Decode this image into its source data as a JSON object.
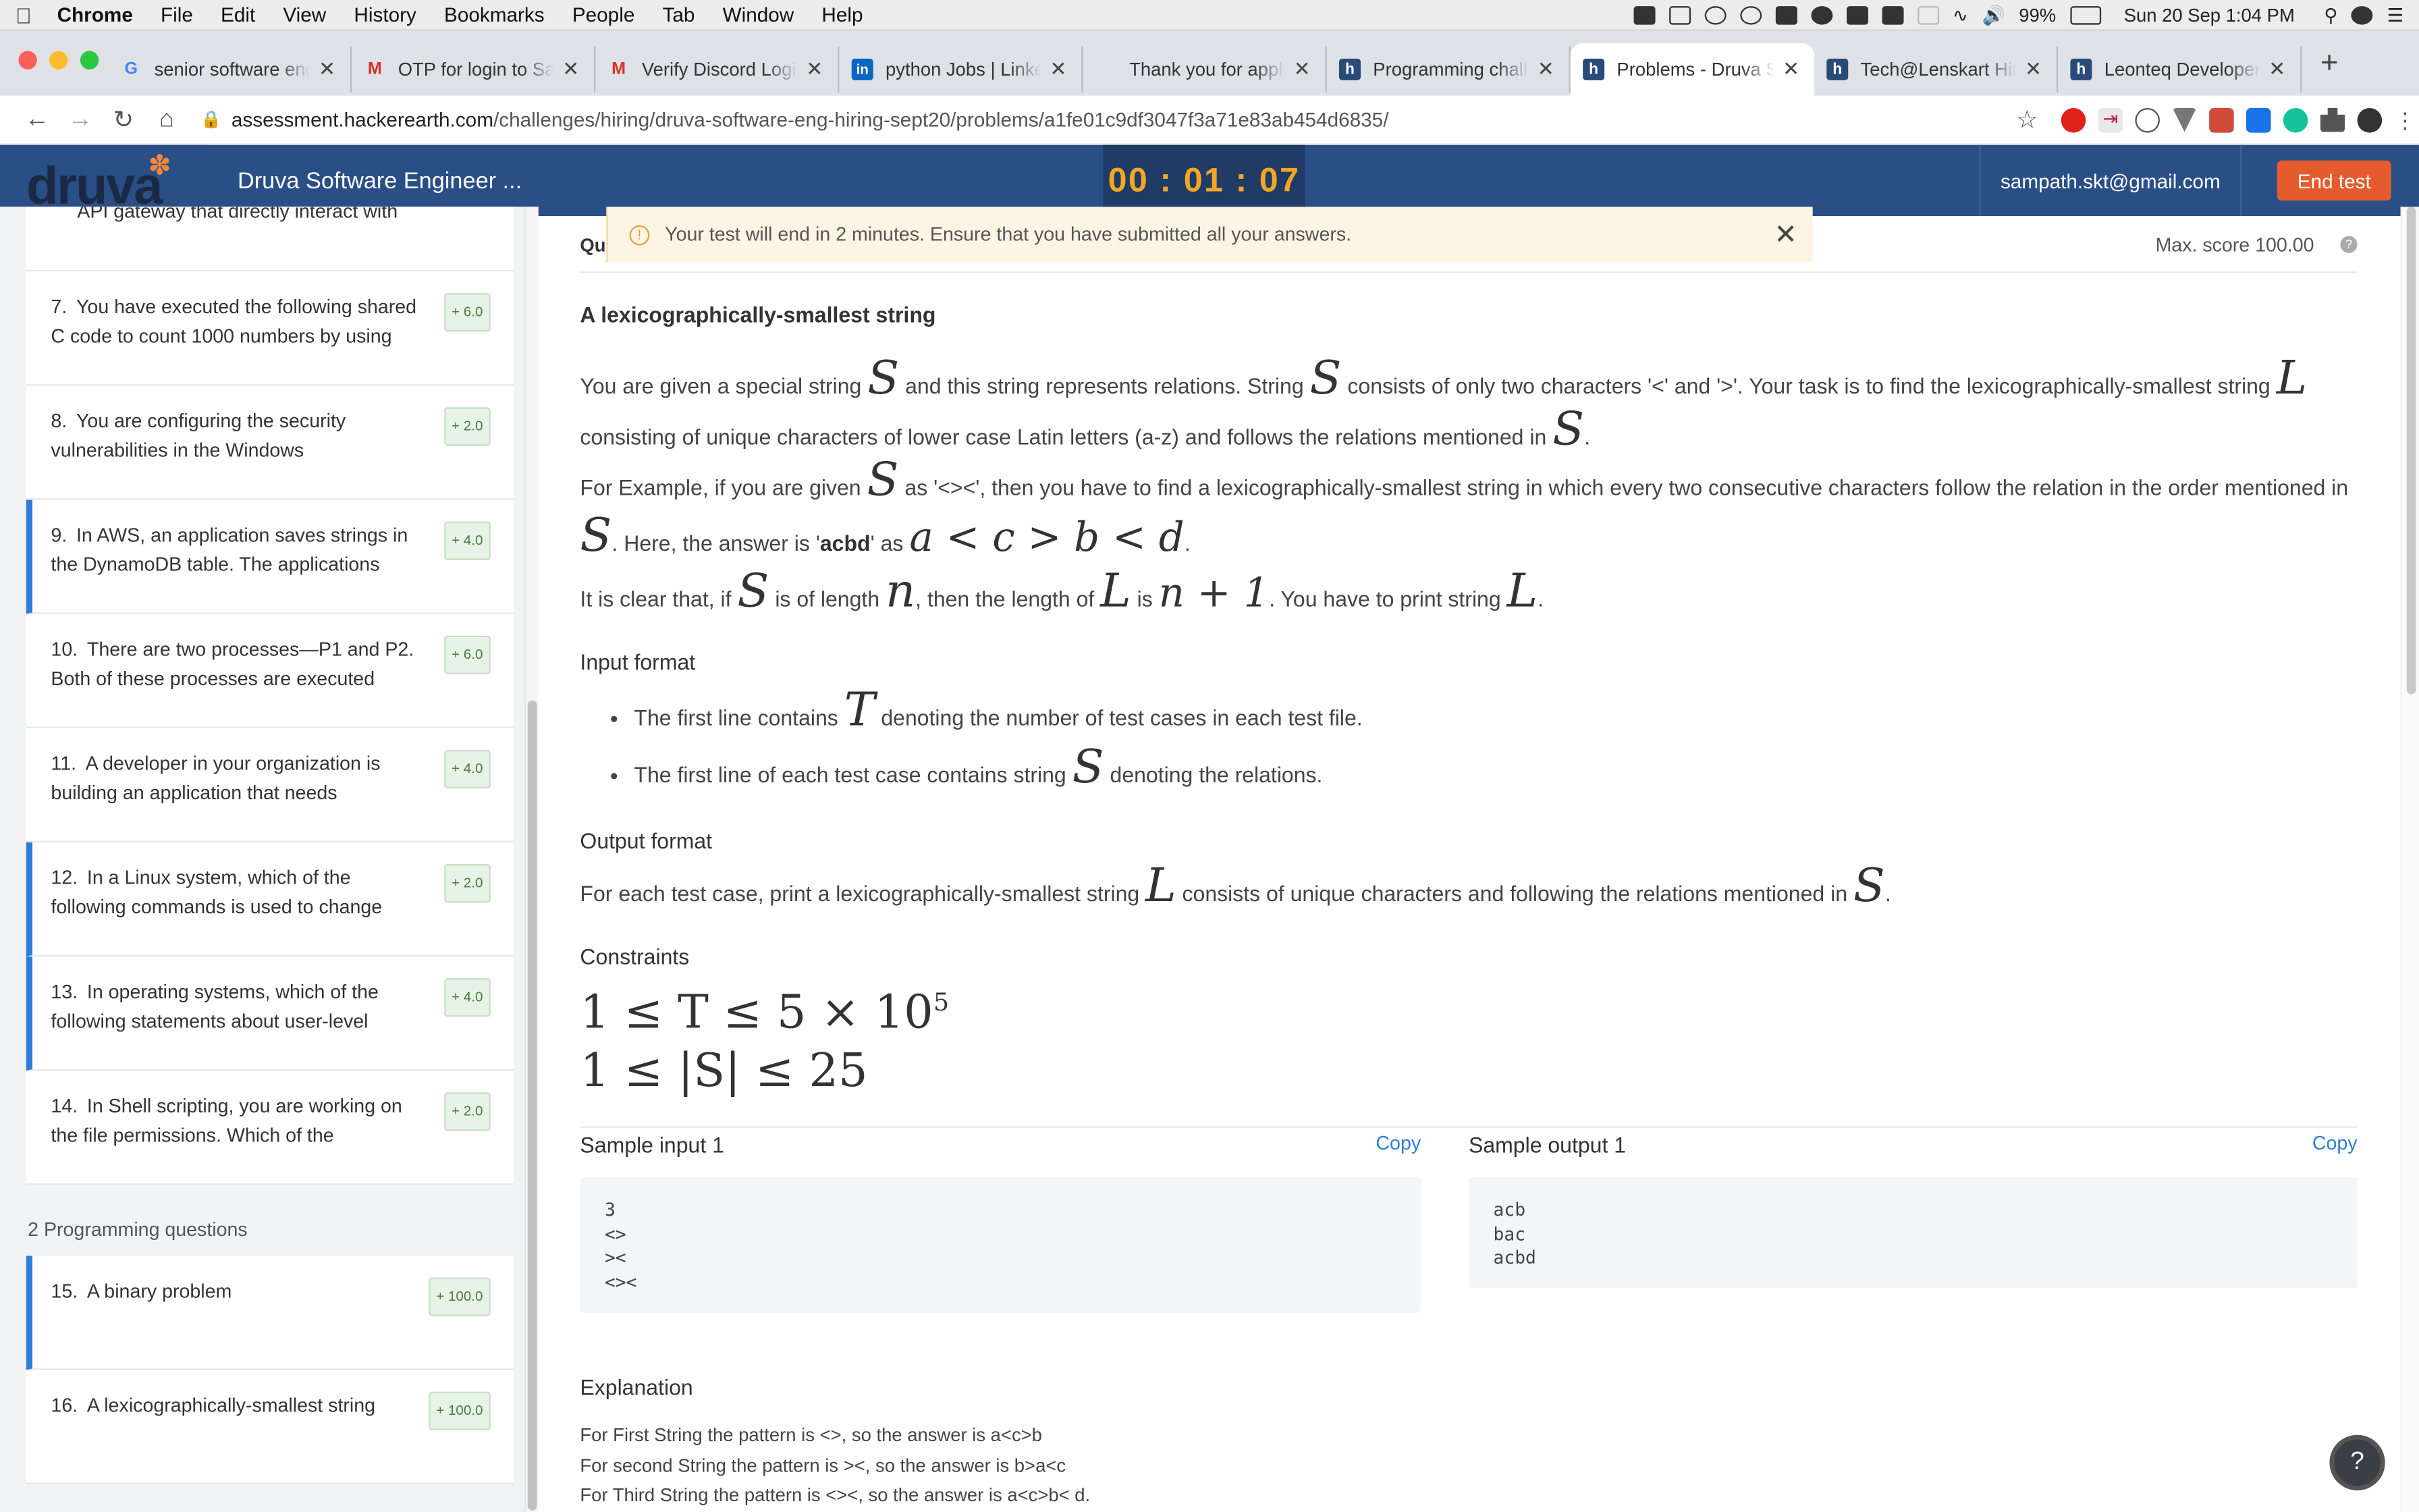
{
  "menubar": {
    "app": "Chrome",
    "items": [
      "File",
      "Edit",
      "View",
      "History",
      "Bookmarks",
      "People",
      "Tab",
      "Window",
      "Help"
    ],
    "battery": "99%",
    "datetime": "Sun 20 Sep  1:04 PM"
  },
  "tabs": [
    {
      "label": "senior software engi",
      "icon": "google-icon",
      "active": false
    },
    {
      "label": "OTP for login to Sam",
      "icon": "gmail-icon",
      "active": false
    },
    {
      "label": "Verify Discord Login",
      "icon": "gmail-icon",
      "active": false
    },
    {
      "label": "python Jobs | Linked",
      "icon": "linkedin-icon",
      "active": false
    },
    {
      "label": "Thank you for applyi",
      "icon": "blank-icon",
      "active": false
    },
    {
      "label": "Programming challen",
      "icon": "hackerearth-icon",
      "active": false
    },
    {
      "label": "Problems - Druva So",
      "icon": "hackerearth-icon",
      "active": true
    },
    {
      "label": "Tech@Lenskart Hirin",
      "icon": "hackerearth-icon",
      "active": false
    },
    {
      "label": "Leonteq Developer H",
      "icon": "hackerearth-icon",
      "active": false
    }
  ],
  "address": {
    "host": "assessment.hackerearth.com",
    "path": "/challenges/hiring/druva-software-eng-hiring-sept20/problems/a1fe01c9df3047f3a71e83ab454d6835/"
  },
  "header": {
    "logo_text": "druva",
    "test_name": "Druva Software Engineer ...",
    "timer": "00 : 01 : 07",
    "email": "sampath.skt@gmail.com",
    "end_test": "End test"
  },
  "sidebar": {
    "top_partial": "API gateway that directly interact with",
    "questions": [
      {
        "num": "7.",
        "text": "You have executed the following shared C code to count 1000 numbers by using",
        "score": "+ 6.0",
        "marked": false
      },
      {
        "num": "8.",
        "text": "You are configuring the security vulnerabilities in the Windows",
        "score": "+ 2.0",
        "marked": false
      },
      {
        "num": "9.",
        "text": "In AWS, an application saves strings in the DynamoDB table. The applications",
        "score": "+ 4.0",
        "marked": true
      },
      {
        "num": "10.",
        "text": "There are two processes—P1 and P2. Both of these processes are executed",
        "score": "+ 6.0",
        "marked": false
      },
      {
        "num": "11.",
        "text": "A developer in your organization is building an application that needs",
        "score": "+ 4.0",
        "marked": false
      },
      {
        "num": "12.",
        "text": "In a Linux system, which of the following commands is used to change",
        "score": "+ 2.0",
        "marked": true
      },
      {
        "num": "13.",
        "text": "In operating systems, which of the following statements about user-level",
        "score": "+ 4.0",
        "marked": true
      },
      {
        "num": "14.",
        "text": "In Shell scripting, you are working on the file permissions. Which of the",
        "score": "+ 2.0",
        "marked": false
      }
    ],
    "section_label": "2 Programming questions",
    "programming": [
      {
        "num": "15.",
        "text": "A binary problem",
        "score": "+ 100.0",
        "marked": true
      },
      {
        "num": "16.",
        "text": "A lexicographically-smallest string",
        "score": "+ 100.0",
        "marked": false
      }
    ]
  },
  "banner": {
    "text": "Your test will end in 2 minutes. Ensure that you have submitted all your answers."
  },
  "problem": {
    "qu_label": "Qu",
    "max_score": "Max. score 100.00",
    "title": "A lexicographically-smallest string",
    "p1a": "You are given a special string",
    "p1b": "and this string represents relations. String",
    "p1c": "consists of only two characters '<' and '>'. Your task is to find the lexicographically-smallest string",
    "p1d": "consisting of unique characters of lower case Latin letters (a-z) and follows the relations mentioned in",
    "p2a": "For Example, if you are given",
    "p2b": "as '<><', then you have to find a lexicographically-smallest string in which every two consecutive characters follow the relation in the order mentioned in",
    "p2c": ". Here, the answer is '",
    "p2ans": "acbd",
    "p2d": "' as",
    "p2math": "a < c > b < d",
    "p3a": "It is clear that, if",
    "p3b": "is of length",
    "p3c": ", then the length of",
    "p3d": "is",
    "p3math": "n + 1",
    "p3e": ". You have to print string",
    "var_S": "S",
    "var_L": "L",
    "var_n": "n",
    "var_T": "T",
    "input_title": "Input format",
    "input_1a": "The first line contains",
    "input_1b": "denoting the number of test cases in each test file.",
    "input_2a": "The first line of each test case contains string",
    "input_2b": "denoting the relations.",
    "output_title": "Output format",
    "output_a": "For each test case, print a lexicographically-smallest string",
    "output_b": "consists of unique characters and following the relations mentioned in",
    "constraints_title": "Constraints",
    "c1": "1 ≤ T ≤ 5 × 10",
    "c1sup": "5",
    "c2": "1 ≤ |S| ≤ 25",
    "sample_in_title": "Sample input 1",
    "sample_out_title": "Sample output 1",
    "copy": "Copy",
    "sample_in": "3\n<>\n><\n<><",
    "sample_out": "acb\nbac\nacbd",
    "explanation_title": "Explanation",
    "exp1": "For First String the pattern is <>, so the answer is a<c>b",
    "exp2": "For second String the pattern is ><, so the answer is b>a<c",
    "exp3": "For Third String the pattern is <><, so the answer is a<c>b< d."
  }
}
